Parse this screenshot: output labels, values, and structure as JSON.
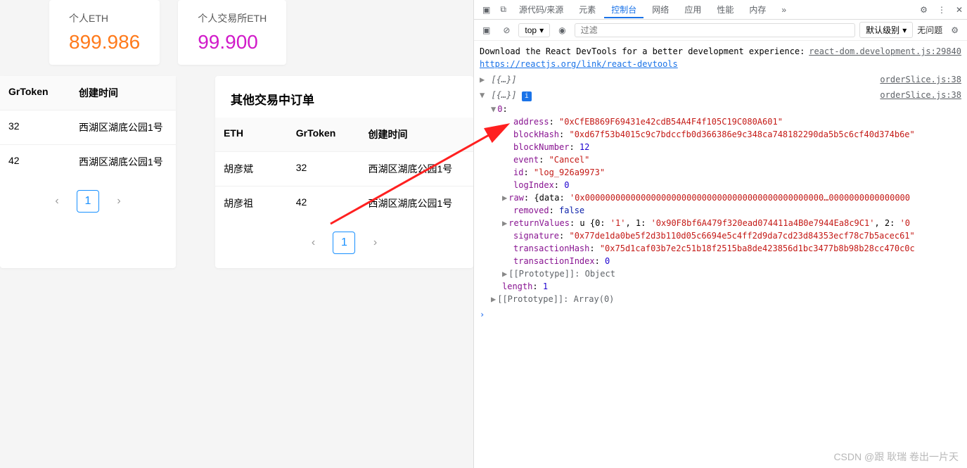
{
  "cards": [
    {
      "label": "个人ETH",
      "value": "899.986"
    },
    {
      "label": "个人交易所ETH",
      "value": "99.900"
    }
  ],
  "leftTable": {
    "headers": [
      "GrToken",
      "创建时间"
    ],
    "rows": [
      [
        "32",
        "西湖区湖底公园1号"
      ],
      [
        "42",
        "西湖区湖底公园1号"
      ]
    ],
    "page": "1"
  },
  "rightTable": {
    "title": "其他交易中订单",
    "headers": [
      "ETH",
      "GrToken",
      "创建时间"
    ],
    "rows": [
      [
        "胡彦斌",
        "32",
        "西湖区湖底公园1号"
      ],
      [
        "胡彦祖",
        "42",
        "西湖区湖底公园1号"
      ]
    ],
    "page": "1"
  },
  "devtools": {
    "tabs": [
      "源代码/来源",
      "元素",
      "控制台",
      "网络",
      "应用",
      "性能",
      "内存"
    ],
    "more": "»",
    "toolbar": {
      "top": "top",
      "filterPlaceholder": "过滤",
      "level": "默认级别",
      "issues": "无问题"
    },
    "downloadMsg": "Download the React DevTools for a better development experience: ",
    "downloadLink": "https://reactjs.org/link/react-devtools",
    "srcFile1": "react-dom.development.js:29840",
    "srcFile2": "orderSlice.js:38",
    "arraySummary": "[{…}]",
    "objIndex": "0",
    "obj": {
      "address": "\"0xCfEB869F69431e42cdB54A4F4f105C19C080A601\"",
      "blockHash": "\"0xd67f53b4015c9c7bdccfb0d366386e9c348ca748182290da5b5c6cf40d374b6e\"",
      "blockNumber": "12",
      "event": "\"Cancel\"",
      "id": "\"log_926a9973\"",
      "logIndex": "0",
      "rawLead": "{data: ",
      "rawVal": "'0x00000000000000000000000000000000000000000000000…0000000000000000",
      "removed": "false",
      "returnValuesLead": "u {0: ",
      "returnValues1": "'1'",
      "returnValues2": ", 1: ",
      "returnValues3": "'0x90F8bf6A479f320ead074411a4B0e7944Ea8c9C1'",
      "returnValues4": ", 2: ",
      "returnValues5": "'0",
      "signature": "\"0x77de1da0be5f2d3b110d05c6694e5c4ff2d9da7cd23d84353ecf78c7b5acec61\"",
      "transactionHash": "\"0x75d1caf03b7e2c51b18f2515ba8de423856d1bc3477b8b98b28cc470c0c",
      "transactionIndex": "0"
    },
    "proto1": "[[Prototype]]: Object",
    "length": "1",
    "proto2": "[[Prototype]]: Array(0)"
  },
  "watermark": "CSDN @跟 耿瑞 卷出一片天"
}
